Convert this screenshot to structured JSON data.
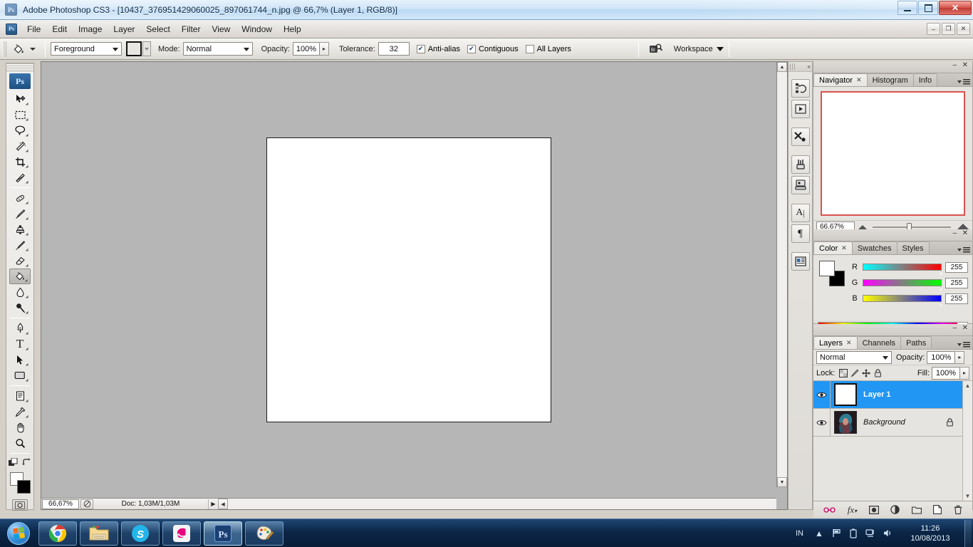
{
  "window": {
    "app_badge": "Ps",
    "title": "Adobe Photoshop CS3 - [10437_376951429060025_897061744_n.jpg @ 66,7% (Layer 1, RGB/8)]",
    "minimize": "–",
    "maximize": "❐",
    "close": "✕"
  },
  "menubar": {
    "icon": "Ps",
    "items": [
      "File",
      "Edit",
      "Image",
      "Layer",
      "Select",
      "Filter",
      "View",
      "Window",
      "Help"
    ],
    "doc_buttons": {
      "minimize": "–",
      "restore": "❐",
      "close": "✕"
    }
  },
  "options_bar": {
    "tool_icon": "paint-bucket",
    "fill_source": "Foreground",
    "mode_label": "Mode:",
    "mode_value": "Normal",
    "opacity_label": "Opacity:",
    "opacity_value": "100%",
    "tolerance_label": "Tolerance:",
    "tolerance_value": "32",
    "antialias_label": "Anti-alias",
    "antialias_checked": true,
    "contiguous_label": "Contiguous",
    "contiguous_checked": true,
    "all_layers_label": "All Layers",
    "all_layers_checked": false,
    "bridge_icon": "Br",
    "workspace_label": "Workspace"
  },
  "toolbox": {
    "logo": "Ps",
    "tools": [
      {
        "name": "move-tool",
        "glyph": "✥"
      },
      {
        "name": "rectangular-marquee-tool",
        "glyph": "▭"
      },
      {
        "name": "lasso-tool",
        "glyph": "◯"
      },
      {
        "name": "magic-wand-tool",
        "glyph": "✧"
      },
      {
        "name": "crop-tool",
        "glyph": "⌗"
      },
      {
        "name": "slice-tool",
        "glyph": "✂"
      },
      {
        "name": "healing-brush-tool",
        "glyph": "✚"
      },
      {
        "name": "brush-tool",
        "glyph": "🖌"
      },
      {
        "name": "clone-stamp-tool",
        "glyph": "⚲"
      },
      {
        "name": "history-brush-tool",
        "glyph": "↯"
      },
      {
        "name": "eraser-tool",
        "glyph": "▰"
      },
      {
        "name": "paint-bucket-tool",
        "glyph": "🪣",
        "selected": true
      },
      {
        "name": "gradient-blur-tool",
        "glyph": "💧"
      },
      {
        "name": "dodge-tool",
        "glyph": "🔴"
      },
      {
        "name": "pen-tool",
        "glyph": "✒"
      },
      {
        "name": "horizontal-type-tool",
        "glyph": "T"
      },
      {
        "name": "path-selection-tool",
        "glyph": "➤"
      },
      {
        "name": "rectangle-shape-tool",
        "glyph": "▬"
      },
      {
        "name": "notes-tool",
        "glyph": "🗒"
      },
      {
        "name": "eyedropper-tool",
        "glyph": "⌇"
      },
      {
        "name": "hand-tool",
        "glyph": "✋"
      },
      {
        "name": "zoom-tool",
        "glyph": "🔍"
      }
    ],
    "swap_colors": "⇄",
    "foreground_color": "#ffffff",
    "background_color": "#000000",
    "quickmask": "◎"
  },
  "document": {
    "canvas_background": "#ffffff",
    "zoom": "66,67%",
    "doc_info": "Doc: 1,03M/1,03M"
  },
  "dock_strip": {
    "buttons": [
      {
        "name": "history-panel-icon",
        "glyph": "↺"
      },
      {
        "name": "actions-panel-icon",
        "glyph": "▶"
      },
      {
        "name": "tool-presets-panel-icon",
        "glyph": "✂"
      },
      {
        "name": "brushes-panel-icon",
        "glyph": "🖌"
      },
      {
        "name": "clone-source-panel-icon",
        "glyph": "⚙"
      },
      {
        "name": "character-panel-icon",
        "glyph": "A"
      },
      {
        "name": "paragraph-panel-icon",
        "glyph": "¶"
      },
      {
        "name": "layer-comps-panel-icon",
        "glyph": "▤"
      }
    ]
  },
  "navigator_panel": {
    "tabs": [
      "Navigator",
      "Histogram",
      "Info"
    ],
    "active_tab": "Navigator",
    "zoom_value": "66.67%",
    "thumb_border_color": "#d9534f"
  },
  "color_panel": {
    "tabs": [
      "Color",
      "Swatches",
      "Styles"
    ],
    "active_tab": "Color",
    "channels": [
      {
        "label": "R",
        "value": "255"
      },
      {
        "label": "G",
        "value": "255"
      },
      {
        "label": "B",
        "value": "255"
      }
    ],
    "foreground": "#ffffff",
    "background": "#000000"
  },
  "layers_panel": {
    "tabs": [
      "Layers",
      "Channels",
      "Paths"
    ],
    "active_tab": "Layers",
    "blend_mode": "Normal",
    "opacity_label": "Opacity:",
    "opacity_value": "100%",
    "lock_label": "Lock:",
    "fill_label": "Fill:",
    "fill_value": "100%",
    "lock_icons": [
      "transparent-pixels-lock",
      "image-pixels-lock",
      "position-lock",
      "all-lock"
    ],
    "layers": [
      {
        "name": "Layer 1",
        "selected": true,
        "visible": true,
        "locked": false,
        "thumb": "white"
      },
      {
        "name": "Background",
        "selected": false,
        "visible": true,
        "locked": true,
        "thumb": "photo"
      }
    ],
    "bottom_buttons": [
      {
        "name": "link-layers-button",
        "glyph": "🔗"
      },
      {
        "name": "layer-style-button",
        "glyph": "fx"
      },
      {
        "name": "layer-mask-button",
        "glyph": "◍"
      },
      {
        "name": "adjustment-layer-button",
        "glyph": "◑"
      },
      {
        "name": "new-group-button",
        "glyph": "🗀"
      },
      {
        "name": "new-layer-button",
        "glyph": "🗋"
      },
      {
        "name": "delete-layer-button",
        "glyph": "🗑"
      }
    ]
  },
  "taskbar": {
    "start_label": "Start",
    "apps": [
      {
        "name": "taskbar-chrome",
        "label": "Google Chrome"
      },
      {
        "name": "taskbar-explorer",
        "label": "Windows Explorer"
      },
      {
        "name": "taskbar-skype",
        "label": "Skype"
      },
      {
        "name": "taskbar-camfrog",
        "label": "Camfrog"
      },
      {
        "name": "taskbar-photoshop",
        "label": "Adobe Photoshop CS3",
        "active": true
      },
      {
        "name": "taskbar-paint",
        "label": "Paint"
      }
    ],
    "language": "IN",
    "tray_icons": [
      "show-hidden-icons",
      "action-center-flag-icon",
      "battery-icon",
      "network-icon",
      "volume-icon"
    ],
    "time": "11:26",
    "date": "10/08/2013"
  }
}
